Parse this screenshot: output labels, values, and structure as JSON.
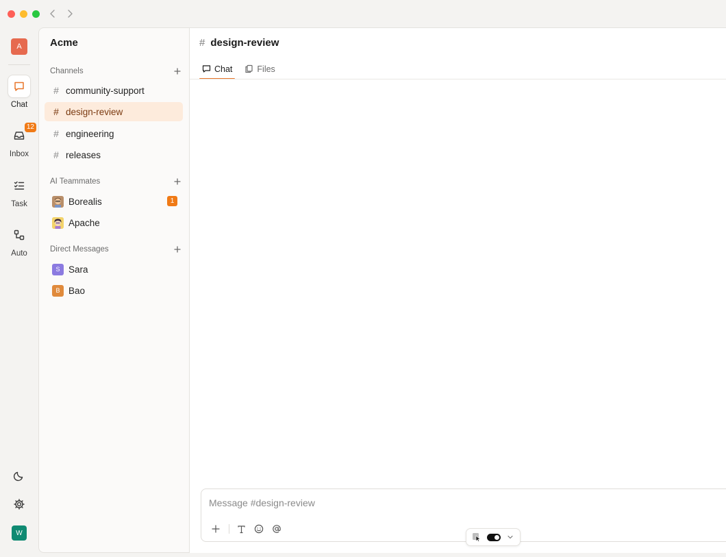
{
  "workspace": {
    "name": "Acme",
    "avatar_initial": "A",
    "avatar_color": "#e66a4f"
  },
  "rail": {
    "items": [
      {
        "label": "Chat",
        "icon": "chat-bubble-icon",
        "active": true
      },
      {
        "label": "Inbox",
        "icon": "inbox-tray-icon",
        "badge": "12"
      },
      {
        "label": "Task",
        "icon": "checklist-icon"
      },
      {
        "label": "Auto",
        "icon": "workflow-icon"
      }
    ],
    "bottom": {
      "theme_icon": "moon-icon",
      "settings_icon": "gear-icon",
      "user_initial": "W",
      "user_color": "#0f8a72"
    }
  },
  "sidebar": {
    "channels": {
      "title": "Channels",
      "items": [
        {
          "label": "community-support"
        },
        {
          "label": "design-review",
          "active": true
        },
        {
          "label": "engineering"
        },
        {
          "label": "releases"
        }
      ]
    },
    "ai_teammates": {
      "title": "AI Teammates",
      "items": [
        {
          "label": "Borealis",
          "badge": "1"
        },
        {
          "label": "Apache"
        }
      ]
    },
    "direct_messages": {
      "title": "Direct Messages",
      "items": [
        {
          "label": "Sara",
          "initial": "S",
          "color": "#8b7ae0"
        },
        {
          "label": "Bao",
          "initial": "B",
          "color": "#e08a3c"
        }
      ]
    }
  },
  "main": {
    "channel_name": "design-review",
    "tabs": [
      {
        "label": "Chat",
        "icon": "chat-bubble-icon",
        "active": true
      },
      {
        "label": "Files",
        "icon": "files-icon"
      }
    ],
    "composer": {
      "placeholder": "Message #design-review",
      "tools": [
        "plus-icon",
        "text-format-icon",
        "emoji-icon",
        "mention-icon"
      ]
    }
  },
  "colors": {
    "accent": "#e8762a",
    "badge": "#f07a16",
    "active_bg": "#fdebdc"
  }
}
